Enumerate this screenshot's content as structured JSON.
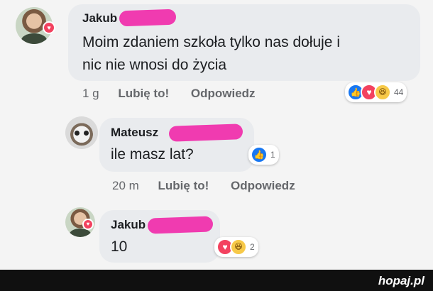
{
  "comments": [
    {
      "author": "Jakub",
      "text_lines": [
        "Moim zdaniem szkoła tylko nas dołuje i",
        "nic nie wnosi do życia"
      ],
      "time": "1 g",
      "like_action": "Lubię to!",
      "reply_action": "Odpowiedz",
      "reactions": [
        "like",
        "love",
        "haha"
      ],
      "reaction_count": "44"
    },
    {
      "author": "Mateusz",
      "text_lines": [
        "ile masz lat?"
      ],
      "time": "20 m",
      "like_action": "Lubię to!",
      "reply_action": "Odpowiedz",
      "reactions": [
        "like"
      ],
      "reaction_count": "1"
    },
    {
      "author": "Jakub",
      "text_lines": [
        "10"
      ],
      "reactions": [
        "love",
        "haha"
      ],
      "reaction_count": "2"
    }
  ],
  "watermark": "hopaj.pl",
  "colors": {
    "redaction": "#f03bb0",
    "like": "#1877f2",
    "love": "#f3425f",
    "haha": "#f7c948"
  },
  "icons": {
    "like": "thumbs-up-icon",
    "love": "heart-icon",
    "haha": "laugh-emoji-icon"
  }
}
